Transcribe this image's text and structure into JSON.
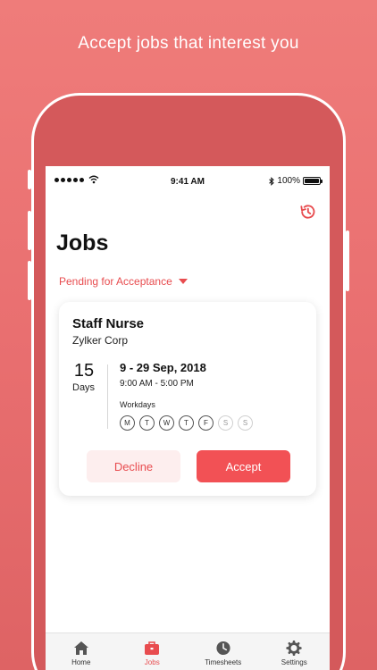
{
  "headline": "Accept jobs that interest you",
  "status_bar": {
    "time": "9:41 AM",
    "battery": "100%"
  },
  "header": {
    "title": "Jobs"
  },
  "filter": {
    "label": "Pending for Acceptance"
  },
  "job": {
    "title": "Staff Nurse",
    "company": "Zylker Corp",
    "duration_value": "15",
    "duration_unit": "Days",
    "date_range": "9 - 29 Sep, 2018",
    "hours": "9:00 AM - 5:00 PM",
    "workdays_label": "Workdays",
    "workdays": [
      {
        "letter": "M",
        "active": true
      },
      {
        "letter": "T",
        "active": true
      },
      {
        "letter": "W",
        "active": true
      },
      {
        "letter": "T",
        "active": true
      },
      {
        "letter": "F",
        "active": true
      },
      {
        "letter": "S",
        "active": false
      },
      {
        "letter": "S",
        "active": false
      }
    ],
    "decline_label": "Decline",
    "accept_label": "Accept"
  },
  "tabs": [
    {
      "label": "Home",
      "icon": "home-icon",
      "active": false
    },
    {
      "label": "Jobs",
      "icon": "briefcase-icon",
      "active": true
    },
    {
      "label": "Timesheets",
      "icon": "clock-icon",
      "active": false
    },
    {
      "label": "Settings",
      "icon": "gear-icon",
      "active": false
    }
  ],
  "colors": {
    "accent": "#e84c4f",
    "accept_button": "#f25155",
    "decline_button_bg": "#fdeeee",
    "background": "#ef7c7a"
  }
}
